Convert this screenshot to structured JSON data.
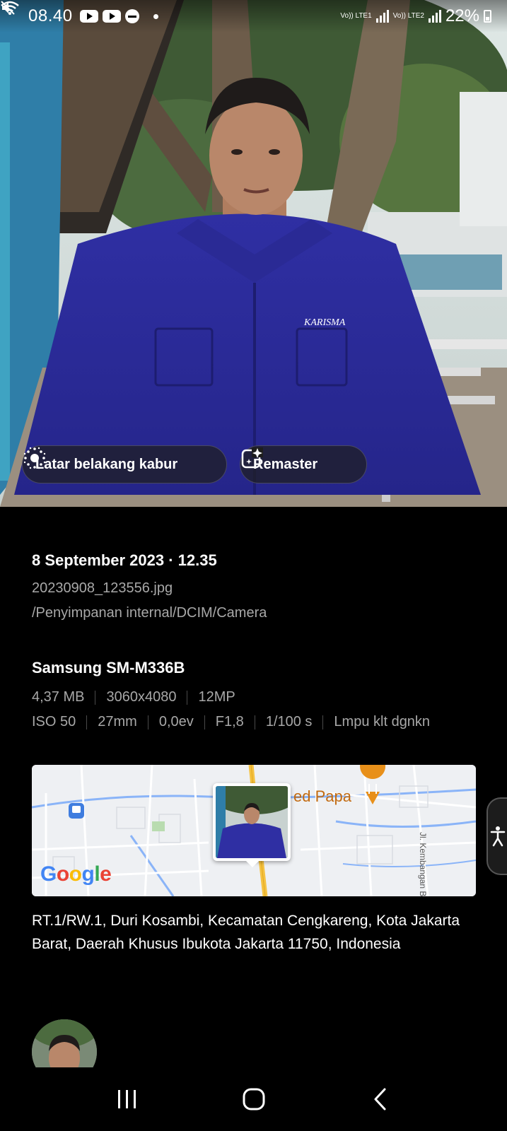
{
  "status_bar": {
    "time": "08.40",
    "battery": "22%",
    "sim1_label": "Vo)) LTE1",
    "sim2_label": "Vo)) LTE2",
    "icons": [
      "youtube-icon",
      "youtube-icon",
      "dnd-icon",
      "dot-icon",
      "mute-icon",
      "wifi-icon",
      "signal-icon",
      "signal-icon",
      "battery-icon"
    ]
  },
  "photo": {
    "chips": {
      "blur_label": "Latar belakang kabur",
      "remaster_label": "Remaster"
    },
    "shirt_text": "KARISMA"
  },
  "details": {
    "date_time": "8 September 2023 · 12.35",
    "filename": "20230908_123556.jpg",
    "path": "/Penyimpanan internal/DCIM/Camera",
    "device": "Samsung SM-M336B",
    "specs_row1": [
      "4,37 MB",
      "3060x4080",
      "12MP"
    ],
    "specs_row2": [
      "ISO 50",
      "27mm",
      "0,0ev",
      "F1,8",
      "1/100 s",
      "Lmpu klt dgnkn"
    ]
  },
  "map": {
    "poi_label": "ed Papa",
    "street_label": "Jl. Kembangan Baru",
    "logo": "Google",
    "colors": {
      "background": "#eef0f3",
      "road": "#ffffff",
      "water": "#8ab4f8",
      "highway": "#f5c242",
      "poi": "#e8901a"
    }
  },
  "address": "RT.1/RW.1, Duri Kosambi, Kecamatan Cengkareng, Kota Jakarta Barat, Daerah Khusus Ibukota Jakarta 11750, Indonesia",
  "navbar": {
    "icons": [
      "recents-icon",
      "home-icon",
      "back-icon"
    ]
  }
}
